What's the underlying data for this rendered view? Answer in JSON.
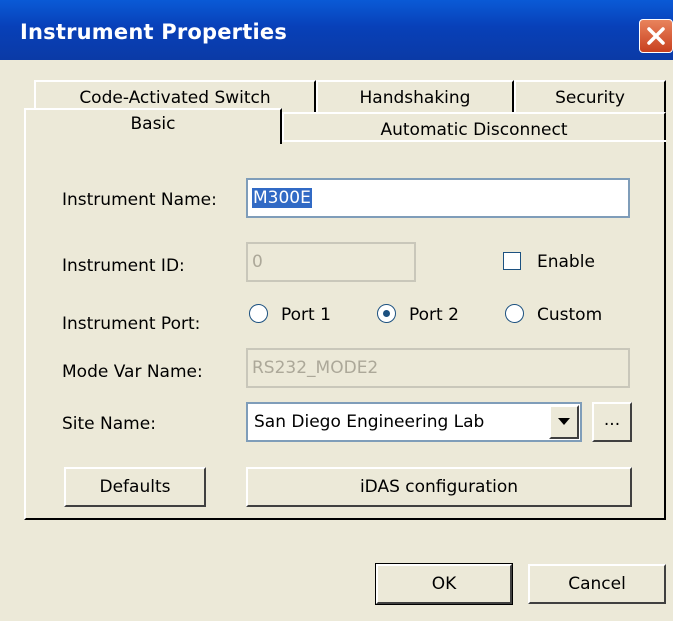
{
  "window": {
    "title": "Instrument Properties",
    "close_icon": "close-icon"
  },
  "tabs": {
    "back_row": [
      "Code-Activated Switch",
      "Handshaking",
      "Security"
    ],
    "front_row": [
      "Basic",
      "Automatic Disconnect"
    ],
    "selected": "Basic"
  },
  "form": {
    "instrument_name": {
      "label": "Instrument Name:",
      "value": "M300E"
    },
    "instrument_id": {
      "label": "Instrument ID:",
      "value": "0",
      "disabled": true
    },
    "enable": {
      "label": "Enable",
      "checked": false
    },
    "instrument_port": {
      "label": "Instrument Port:",
      "options": [
        "Port 1",
        "Port 2",
        "Custom"
      ],
      "selected": "Port 2"
    },
    "mode_var_name": {
      "label": "Mode Var Name:",
      "value": "RS232_MODE2",
      "disabled": true
    },
    "site_name": {
      "label": "Site Name:",
      "value": "San Diego Engineering Lab",
      "browse_label": "..."
    },
    "defaults_label": "Defaults",
    "idas_label": "iDAS configuration"
  },
  "footer": {
    "ok_label": "OK",
    "cancel_label": "Cancel"
  }
}
